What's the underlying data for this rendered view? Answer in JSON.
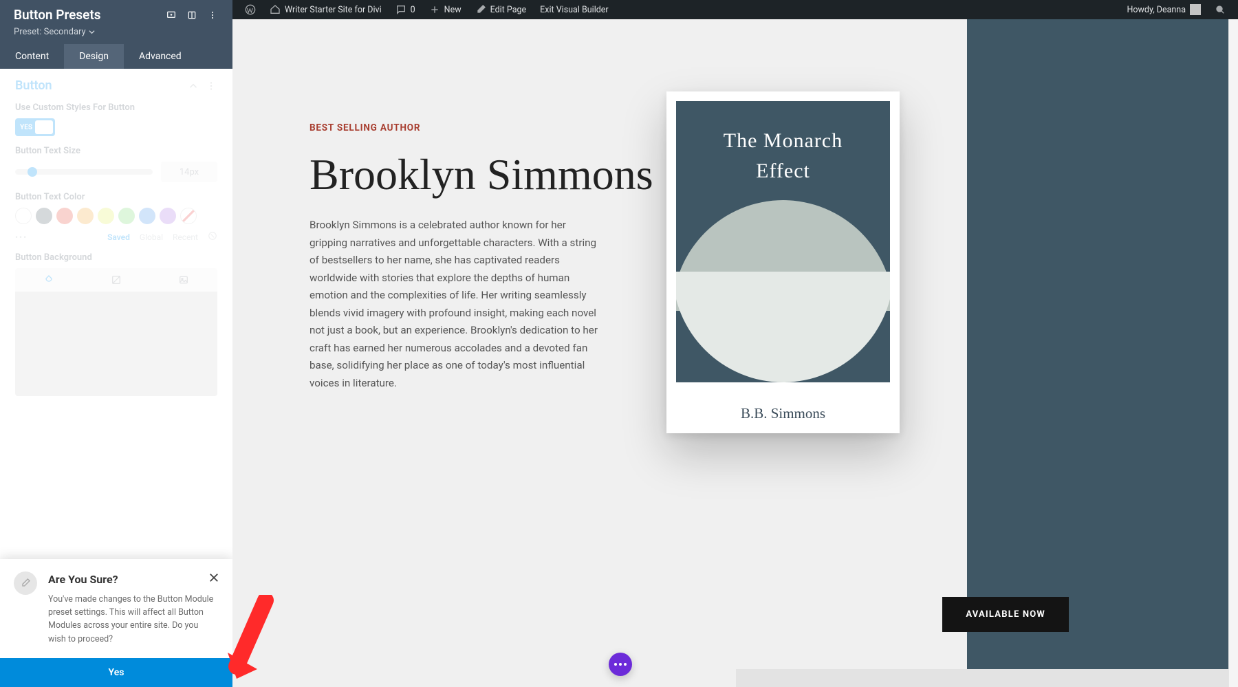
{
  "sidebar": {
    "title": "Button Presets",
    "preset_label": "Preset: Secondary",
    "tabs": {
      "content": "Content",
      "design": "Design",
      "advanced": "Advanced"
    },
    "section_label": "Button",
    "use_custom_label": "Use Custom Styles For Button",
    "toggle_yes": "YES",
    "text_size_label": "Button Text Size",
    "text_size_value": "14px",
    "text_color_label": "Button Text Color",
    "saved": "Saved",
    "global": "Global",
    "recent": "Recent",
    "bg_label": "Button Background",
    "swatch_colors": [
      "#ffffff",
      "#748186",
      "#ec6d5e",
      "#f4b860",
      "#e6f27b",
      "#8fe08b",
      "#6aa8ef",
      "#b88ce8"
    ]
  },
  "confirm": {
    "title": "Are You Sure?",
    "message": "You've made changes to the Button Module preset settings. This will affect all Button Modules across your entire site. Do you wish to proceed?",
    "yes": "Yes"
  },
  "wpbar": {
    "site_name": "Writer Starter Site for Divi",
    "comments": "0",
    "new": "New",
    "edit": "Edit Page",
    "exit": "Exit Visual Builder",
    "howdy": "Howdy, Deanna"
  },
  "page": {
    "eyebrow": "BEST SELLING AUTHOR",
    "author": "Brooklyn Simmons",
    "bio": "Brooklyn Simmons is a celebrated author known for her gripping narratives and unforgettable characters. With a string of bestsellers to her name, she has captivated readers worldwide with stories that explore the depths of human emotion and the complexities of life. Her writing seamlessly blends vivid imagery with profound insight, making each novel not just a book, but an experience. Brooklyn's dedication to her craft has earned her numerous accolades and a devoted fan base, solidifying her place as one of today's most influential voices in literature.",
    "book_title_l1": "The Monarch",
    "book_title_l2": "Effect",
    "book_author": "B.B. Simmons",
    "cta": "AVAILABLE NOW"
  }
}
